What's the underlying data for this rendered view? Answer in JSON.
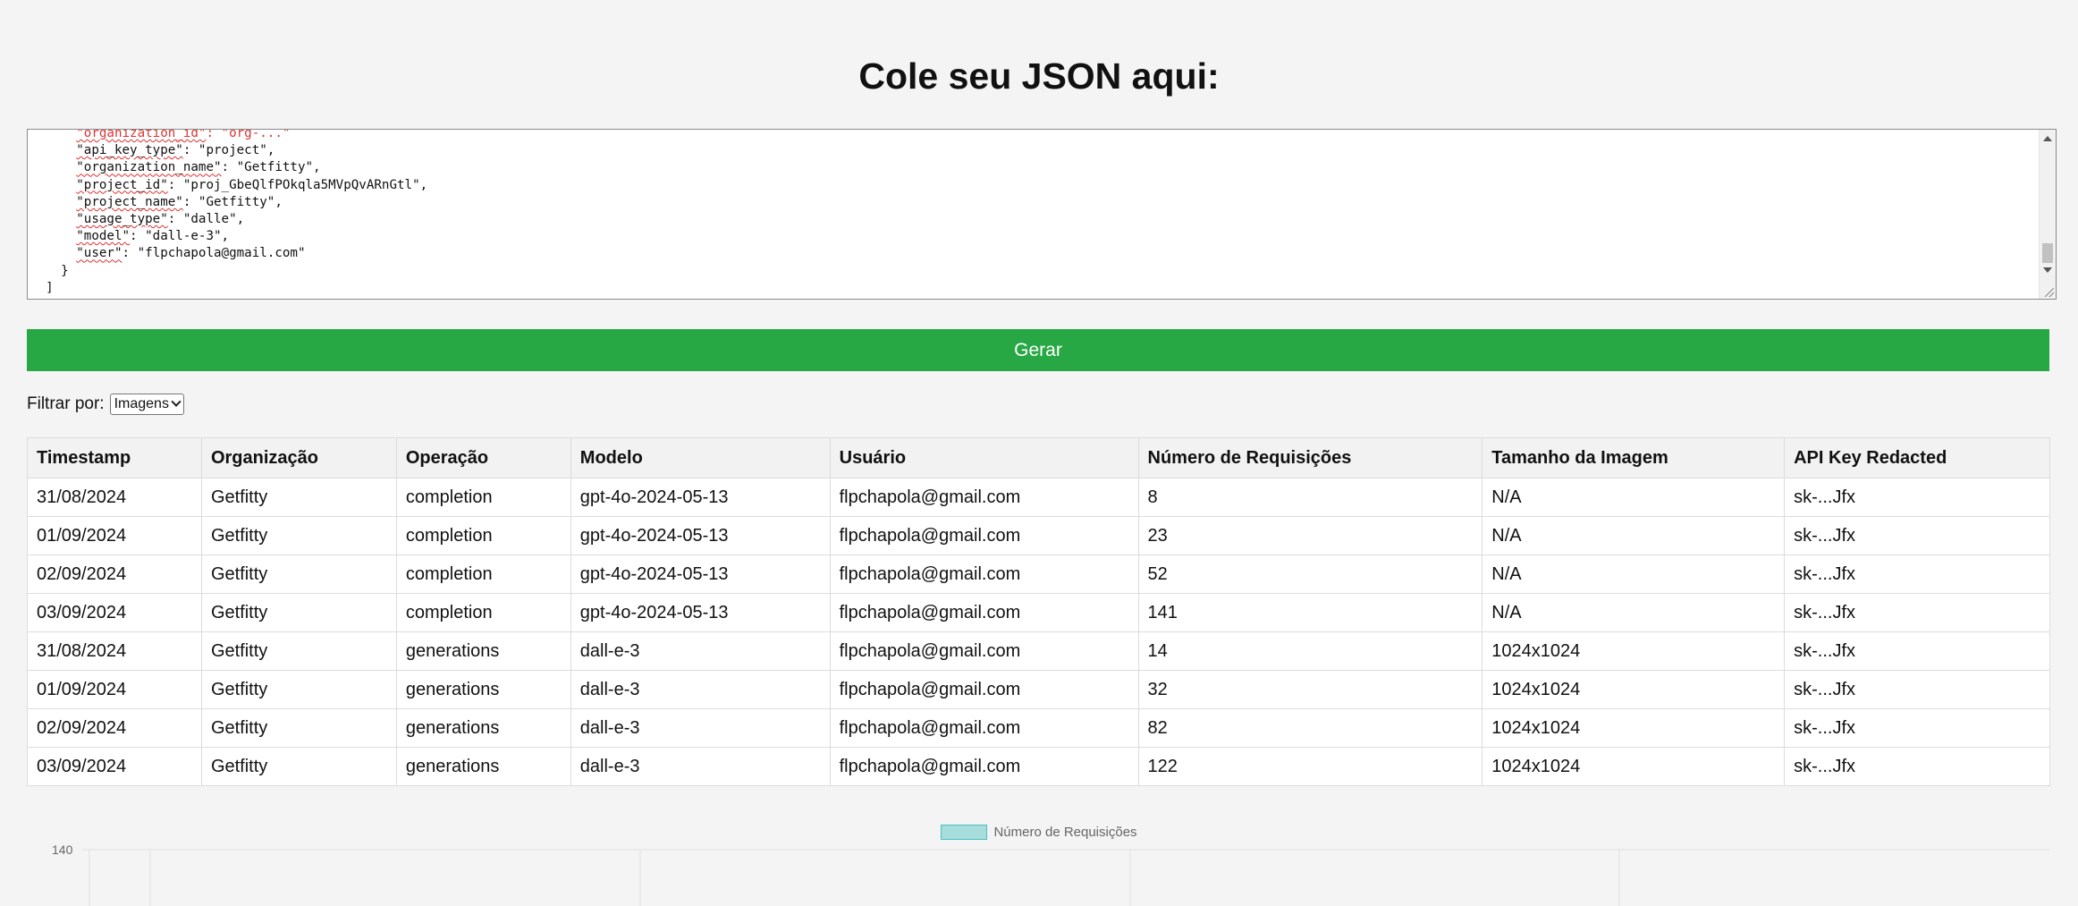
{
  "page": {
    "title": "Cole seu JSON aqui:"
  },
  "json_input": {
    "lines": [
      {
        "i": "      ",
        "k": "\"organization_id\"",
        "v": ": \"org-...\"",
        "cut": true
      },
      {
        "i": "      ",
        "k": "\"api_key_type\"",
        "v": ": \"project\","
      },
      {
        "i": "      ",
        "k": "\"organization_name\"",
        "v": ": \"Getfitty\","
      },
      {
        "i": "      ",
        "k": "\"project_id\"",
        "v": ": \"proj_GbeQlfPOkqla5MVpQvARnGtl\","
      },
      {
        "i": "      ",
        "k": "\"project_name\"",
        "v": ": \"Getfitty\","
      },
      {
        "i": "      ",
        "k": "\"usage_type\"",
        "v": ": \"dalle\","
      },
      {
        "i": "      ",
        "k": "\"model\"",
        "v": ": \"dall-e-3\","
      },
      {
        "i": "      ",
        "k": "\"user\"",
        "v": ": \"flpchapola@gmail.com\""
      },
      {
        "i": "    ",
        "k": "",
        "v": "}"
      },
      {
        "i": "  ",
        "k": "",
        "v": "]"
      },
      {
        "i": "",
        "k": "",
        "v": "}"
      }
    ]
  },
  "generate_button": {
    "label": "Gerar"
  },
  "filter": {
    "label": "Filtrar por:",
    "selected": "Imagens"
  },
  "table": {
    "columns": [
      "Timestamp",
      "Organização",
      "Operação",
      "Modelo",
      "Usuário",
      "Número de Requisições",
      "Tamanho da Imagem",
      "API Key Redacted"
    ],
    "rows": [
      [
        "31/08/2024",
        "Getfitty",
        "completion",
        "gpt-4o-2024-05-13",
        "flpchapola@gmail.com",
        "8",
        "N/A",
        "sk-...Jfx"
      ],
      [
        "01/09/2024",
        "Getfitty",
        "completion",
        "gpt-4o-2024-05-13",
        "flpchapola@gmail.com",
        "23",
        "N/A",
        "sk-...Jfx"
      ],
      [
        "02/09/2024",
        "Getfitty",
        "completion",
        "gpt-4o-2024-05-13",
        "flpchapola@gmail.com",
        "52",
        "N/A",
        "sk-...Jfx"
      ],
      [
        "03/09/2024",
        "Getfitty",
        "completion",
        "gpt-4o-2024-05-13",
        "flpchapola@gmail.com",
        "141",
        "N/A",
        "sk-...Jfx"
      ],
      [
        "31/08/2024",
        "Getfitty",
        "generations",
        "dall-e-3",
        "flpchapola@gmail.com",
        "14",
        "1024x1024",
        "sk-...Jfx"
      ],
      [
        "01/09/2024",
        "Getfitty",
        "generations",
        "dall-e-3",
        "flpchapola@gmail.com",
        "32",
        "1024x1024",
        "sk-...Jfx"
      ],
      [
        "02/09/2024",
        "Getfitty",
        "generations",
        "dall-e-3",
        "flpchapola@gmail.com",
        "82",
        "1024x1024",
        "sk-...Jfx"
      ],
      [
        "03/09/2024",
        "Getfitty",
        "generations",
        "dall-e-3",
        "flpchapola@gmail.com",
        "122",
        "1024x1024",
        "sk-...Jfx"
      ]
    ]
  },
  "chart": {
    "legend_label": "Número de Requisições",
    "y_max_label": "140",
    "colors": {
      "fill": "rgba(75,192,192,0.45)",
      "border": "#4bc0c0"
    }
  },
  "colors": {
    "button": "#28a745",
    "background": "#f4f4f4"
  }
}
